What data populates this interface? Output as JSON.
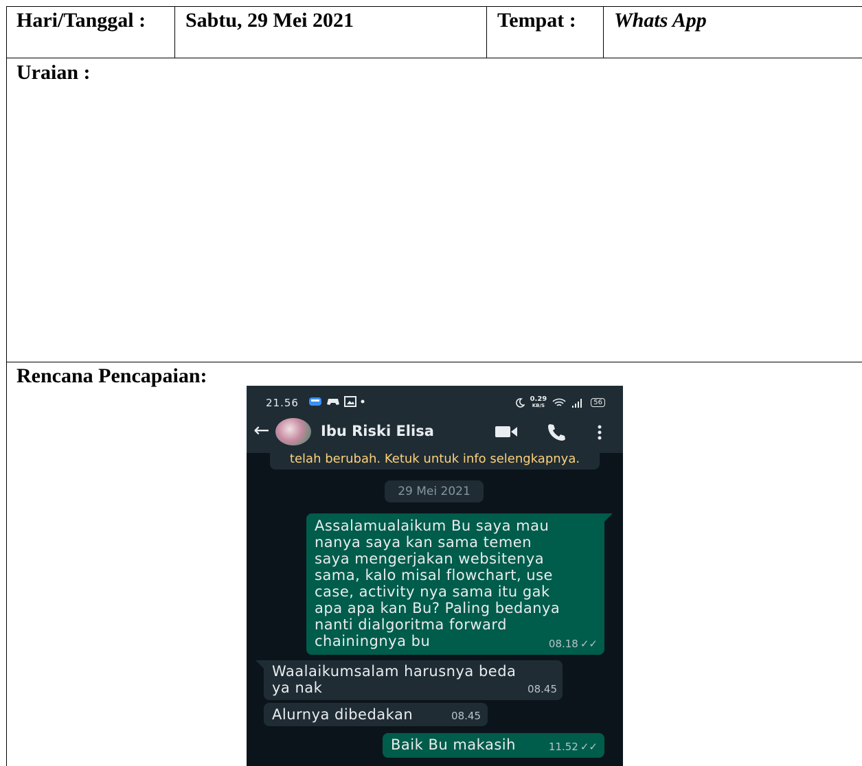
{
  "table": {
    "day_label": "Hari/Tanggal :",
    "day_value": "Sabtu, 29 Mei 2021",
    "place_label": "Tempat :",
    "place_value": "Whats App",
    "description_label": "Uraian :",
    "plan_label": "Rencana Pencapaian:"
  },
  "phone": {
    "status_time": "21.56",
    "status_speed": "0.29",
    "status_speed_unit": "KB/S",
    "battery": "56",
    "contact_name": "Ibu Riski Elisa",
    "notice_text": "telah berubah. Ketuk untuk info selengkapnya.",
    "date_chip": "29 Mei 2021",
    "messages": [
      {
        "direction": "outgoing",
        "text": "Assalamualaikum Bu saya mau\nnanya saya kan sama temen\nsaya mengerjakan websitenya\nsama, kalo misal flowchart, use\ncase, activity nya sama itu gak\napa apa kan Bu? Paling bedanya\nnanti dialgoritma forward\nchainingnya bu",
        "time": "08.18",
        "status": "read"
      },
      {
        "direction": "incoming",
        "text": "Waalaikumsalam harusnya beda\nya nak",
        "time": "08.45"
      },
      {
        "direction": "incoming",
        "text": "Alurnya dibedakan",
        "time": "08.45"
      },
      {
        "direction": "outgoing",
        "text": "Baik Bu makasih",
        "time": "11.52",
        "status": "read"
      }
    ],
    "colors": {
      "header": "#1f2c34",
      "chat_bg": "#0b141a",
      "outgoing_bubble": "#005c4b",
      "incoming_bubble": "#1f2c34",
      "notice_text": "#ffd279"
    },
    "icons": [
      "back-arrow-icon",
      "video-call-icon",
      "phone-call-icon",
      "more-options-icon"
    ]
  }
}
